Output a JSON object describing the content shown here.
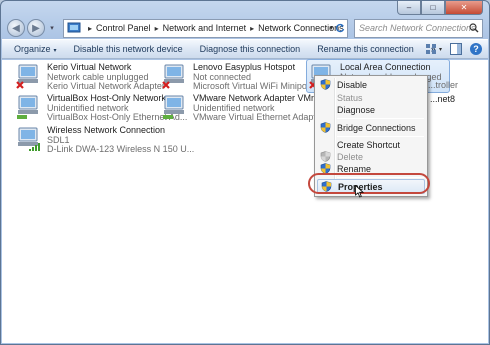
{
  "titlebar": {
    "min_glyph": "–",
    "max_glyph": "□",
    "close_glyph": "✕"
  },
  "nav": {
    "back_glyph": "◀",
    "forward_glyph": "▶",
    "dropdown_glyph": "▾",
    "breadcrumbs": [
      "Control Panel",
      "Network and Internet",
      "Network Connections"
    ],
    "separator": "▸",
    "search_placeholder": "Search Network Connections"
  },
  "commandbar": {
    "organize": "Organize",
    "disable": "Disable this network device",
    "diagnose": "Diagnose this connection",
    "rename": "Rename this connection",
    "more": "»"
  },
  "colors": {
    "accent": "#2f74c7",
    "selection_border": "#84acdd",
    "highlight_ring": "#c4483d"
  },
  "connections": [
    {
      "name": "Kerio Virtual Network",
      "status": "Network cable unplugged",
      "device": "Kerio Virtual Network Adapter",
      "icon": "network-unplugged-icon",
      "badge": "x"
    },
    {
      "name": "Lenovo Easyplus Hotspot",
      "status": "Not connected",
      "device": "Microsoft Virtual WiFi Miniport A...",
      "icon": "network-unplugged-icon",
      "badge": "x"
    },
    {
      "name": "Local Area Connection",
      "status": "Network cable unplugged",
      "device": "...troller",
      "icon": "network-unplugged-icon",
      "badge": "x"
    },
    {
      "name": "VirtualBox Host-Only Network",
      "status": "Unidentified network",
      "device": "VirtualBox Host-Only Ethernet Ad...",
      "icon": "network-connected-icon",
      "badge": ""
    },
    {
      "name": "VMware Network Adapter VMnet1",
      "status": "Unidentified network",
      "device": "VMware Virtual Ethernet Adapter ...",
      "icon": "network-connected-icon",
      "badge": ""
    },
    {
      "name": "...net8",
      "status": "",
      "device": "",
      "icon": "",
      "badge": ""
    },
    {
      "name": "Wireless Network Connection",
      "status": "SDL1",
      "device": "D-Link DWA-123 Wireless N 150 U...",
      "icon": "wireless-network-icon",
      "badge": ""
    }
  ],
  "context_menu": {
    "items": [
      {
        "label": "Disable",
        "shield": true,
        "disabled": false,
        "bold": false
      },
      {
        "label": "Status",
        "shield": false,
        "disabled": true,
        "bold": false
      },
      {
        "label": "Diagnose",
        "shield": false,
        "disabled": false,
        "bold": false
      },
      {
        "label": "Bridge Connections",
        "shield": true,
        "disabled": false,
        "bold": false
      },
      {
        "label": "Create Shortcut",
        "shield": false,
        "disabled": false,
        "bold": false
      },
      {
        "label": "Delete",
        "shield": true,
        "disabled": true,
        "bold": false
      },
      {
        "label": "Rename",
        "shield": true,
        "disabled": false,
        "bold": false
      },
      {
        "label": "Properties",
        "shield": true,
        "disabled": false,
        "bold": true
      }
    ]
  }
}
